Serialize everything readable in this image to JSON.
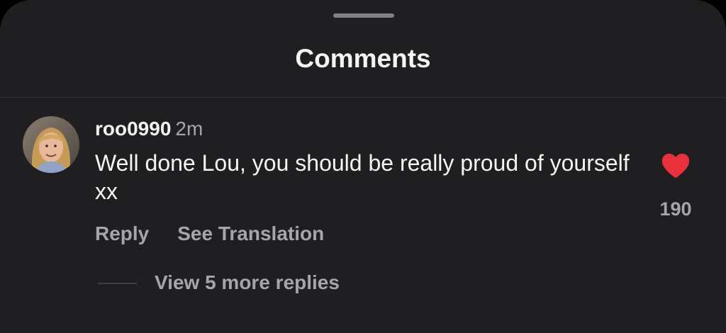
{
  "sheet": {
    "title": "Comments",
    "background": "#1f1f22"
  },
  "comment": {
    "username": "roo0990",
    "time": "2m",
    "text": "Well done Lou, you should be really proud of yourself xx",
    "avatar_icon": "user-avatar",
    "like_icon": "heart-filled-icon",
    "like_color": "#e8313a",
    "like_count": "190",
    "actions": {
      "reply_label": "Reply",
      "translate_label": "See Translation"
    },
    "view_replies_label": "View 5 more replies"
  }
}
